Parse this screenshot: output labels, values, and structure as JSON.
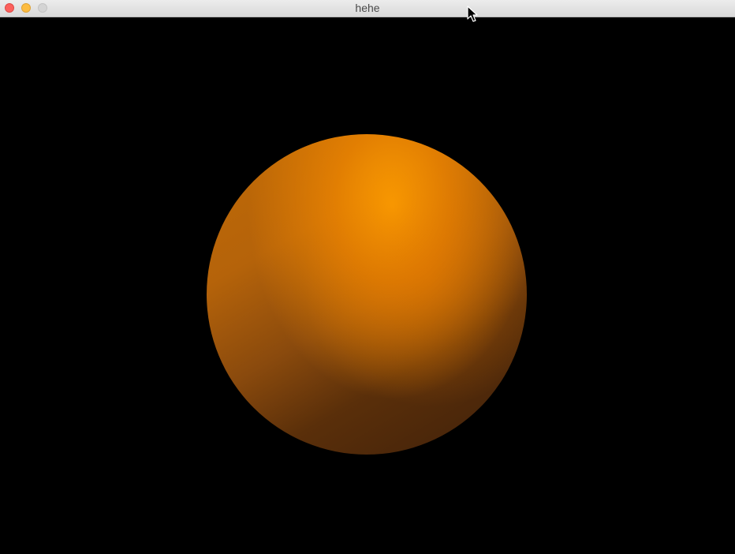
{
  "window": {
    "title": "hehe"
  },
  "scene": {
    "object": "sphere",
    "sphere_color": "#f08a00",
    "background_color": "#000000"
  },
  "colors": {
    "close": "#fc605c",
    "minimize": "#fdbc40",
    "maximize": "#d4d4d4"
  },
  "icons": {
    "cursor": "cursor-icon"
  }
}
